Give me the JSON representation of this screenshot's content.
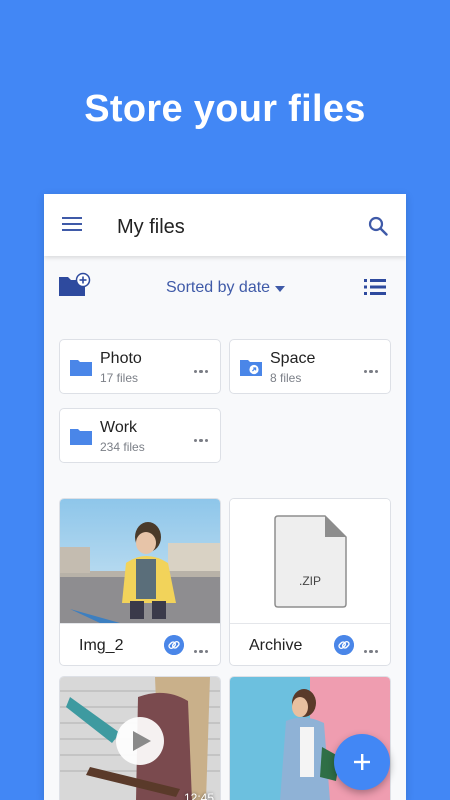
{
  "hero": {
    "title": "Store your files"
  },
  "appbar": {
    "title": "My files",
    "menu_icon": "hamburger-menu-icon",
    "search_icon": "search-icon"
  },
  "toolbar": {
    "sort_label": "Sorted by date",
    "new_folder_icon": "new-folder-icon",
    "view_icon": "list-view-icon"
  },
  "folders": [
    {
      "name": "Photo",
      "count": "17 files",
      "shared": false
    },
    {
      "name": "Space",
      "count": "8 files",
      "shared": true
    },
    {
      "name": "Work",
      "count": "234 files",
      "shared": false
    }
  ],
  "files": [
    {
      "name": "Img_2",
      "type": "image",
      "linked": true
    },
    {
      "name": "Archive",
      "type": "zip",
      "badge": ".ZIP",
      "linked": true
    },
    {
      "name": "",
      "type": "video",
      "duration": "12:45"
    },
    {
      "name": "",
      "type": "image"
    }
  ],
  "fab": {
    "icon": "plus-icon"
  },
  "colors": {
    "accent": "#4287f5",
    "folder": "#4a86e8",
    "sort_text": "#3f5aa8"
  }
}
